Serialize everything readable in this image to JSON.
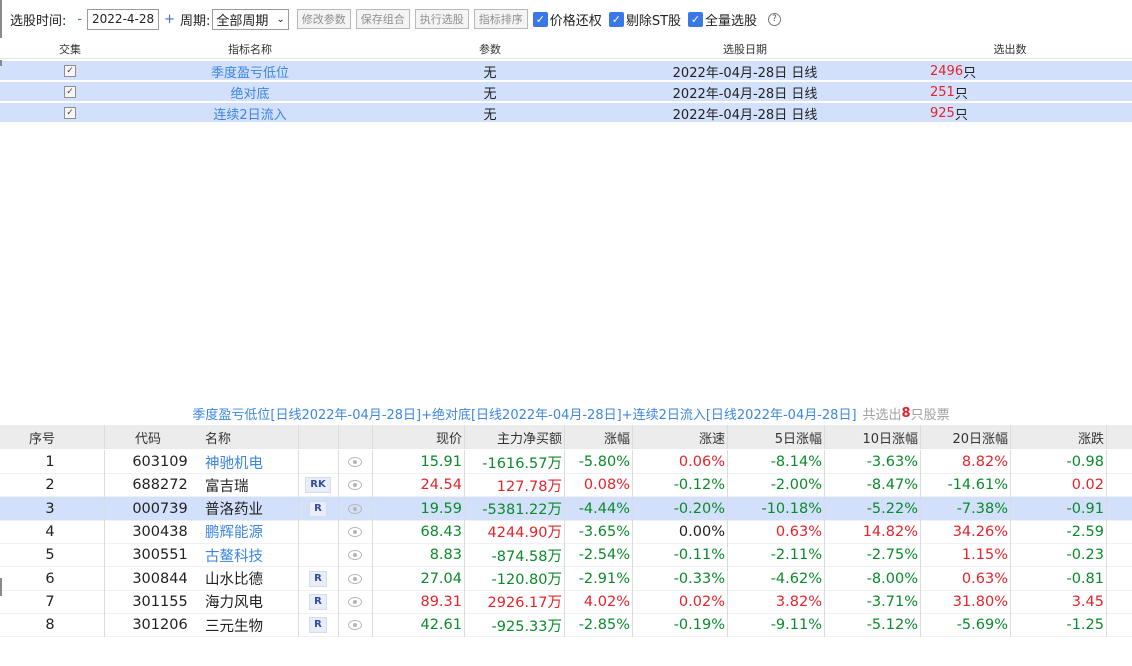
{
  "toolbar": {
    "select_time_label": "选股时间:",
    "minus": "-",
    "date": "2022-4-28",
    "plus": "+",
    "period_label": "周期:",
    "period_value": "全部周期",
    "buttons": [
      "修改参数",
      "保存组合",
      "执行选股",
      "指标排序"
    ],
    "checkboxes": [
      "价格还权",
      "剔除ST股",
      "全量选股"
    ],
    "help": "?"
  },
  "combo": {
    "headers": [
      "交集",
      "指标名称",
      "参数",
      "选股日期",
      "选出数"
    ],
    "rows": [
      {
        "name": "季度盈亏低位",
        "param": "无",
        "date": "2022年-04月-28日 日线",
        "count": "2496",
        "unit": "只"
      },
      {
        "name": "绝对底",
        "param": "无",
        "date": "2022年-04月-28日 日线",
        "count": "251",
        "unit": "只"
      },
      {
        "name": "连续2日流入",
        "param": "无",
        "date": "2022年-04月-28日 日线",
        "count": "925",
        "unit": "只"
      }
    ]
  },
  "summary": {
    "formula": "季度盈亏低位[日线2022年-04月-28日]+绝对底[日线2022年-04月-28日]+连续2日流入[日线2022年-04月-28日]",
    "prefix": "共选出",
    "count": "8",
    "suffix": "只股票"
  },
  "stocks": {
    "headers": [
      "序号",
      "代码",
      "名称",
      "现价",
      "主力净买额",
      "涨幅",
      "涨速",
      "5日涨幅",
      "10日涨幅",
      "20日涨幅",
      "涨跌"
    ],
    "rows": [
      {
        "seq": "1",
        "code": "603109",
        "name": "神驰机电",
        "link": true,
        "badge": "",
        "price": "15.91",
        "flow": "-1616.57万",
        "chg": "-5.80%",
        "spd": "0.06%",
        "d5": "-8.14%",
        "d10": "-3.63%",
        "d20": "8.82%",
        "ud": "-0.98"
      },
      {
        "seq": "2",
        "code": "688272",
        "name": "富吉瑞",
        "link": false,
        "badge": "RK",
        "price": "24.54",
        "flow": "127.78万",
        "chg": "0.08%",
        "spd": "-0.12%",
        "d5": "-2.00%",
        "d10": "-8.47%",
        "d20": "-14.61%",
        "ud": "0.02"
      },
      {
        "seq": "3",
        "code": "000739",
        "name": "普洛药业",
        "link": false,
        "badge": "R",
        "price": "19.59",
        "flow": "-5381.22万",
        "chg": "-4.44%",
        "spd": "-0.20%",
        "d5": "-10.18%",
        "d10": "-5.22%",
        "d20": "-7.38%",
        "ud": "-0.91"
      },
      {
        "seq": "4",
        "code": "300438",
        "name": "鹏辉能源",
        "link": true,
        "badge": "",
        "price": "68.43",
        "flow": "4244.90万",
        "chg": "-3.65%",
        "spd": "0.00%",
        "d5": "0.63%",
        "d10": "14.82%",
        "d20": "34.26%",
        "ud": "-2.59"
      },
      {
        "seq": "5",
        "code": "300551",
        "name": "古鳌科技",
        "link": true,
        "badge": "",
        "price": "8.83",
        "flow": "-874.58万",
        "chg": "-2.54%",
        "spd": "-0.11%",
        "d5": "-2.11%",
        "d10": "-2.75%",
        "d20": "1.15%",
        "ud": "-0.23"
      },
      {
        "seq": "6",
        "code": "300844",
        "name": "山水比德",
        "link": false,
        "badge": "R",
        "price": "27.04",
        "flow": "-120.80万",
        "chg": "-2.91%",
        "spd": "-0.33%",
        "d5": "-4.62%",
        "d10": "-8.00%",
        "d20": "0.63%",
        "ud": "-0.81"
      },
      {
        "seq": "7",
        "code": "301155",
        "name": "海力风电",
        "link": false,
        "badge": "R",
        "price": "89.31",
        "flow": "2926.17万",
        "chg": "4.02%",
        "spd": "0.02%",
        "d5": "3.82%",
        "d10": "-3.71%",
        "d20": "31.80%",
        "ud": "3.45"
      },
      {
        "seq": "8",
        "code": "301206",
        "name": "三元生物",
        "link": false,
        "badge": "R",
        "price": "42.61",
        "flow": "-925.33万",
        "chg": "-2.85%",
        "spd": "-0.19%",
        "d5": "-9.11%",
        "d10": "-5.12%",
        "d20": "-5.69%",
        "ud": "-1.25"
      }
    ]
  },
  "colors": {
    "up": "#e6232b",
    "down": "#0a8a2a",
    "link": "#3d86e0",
    "selected": "#d2e0fb"
  }
}
